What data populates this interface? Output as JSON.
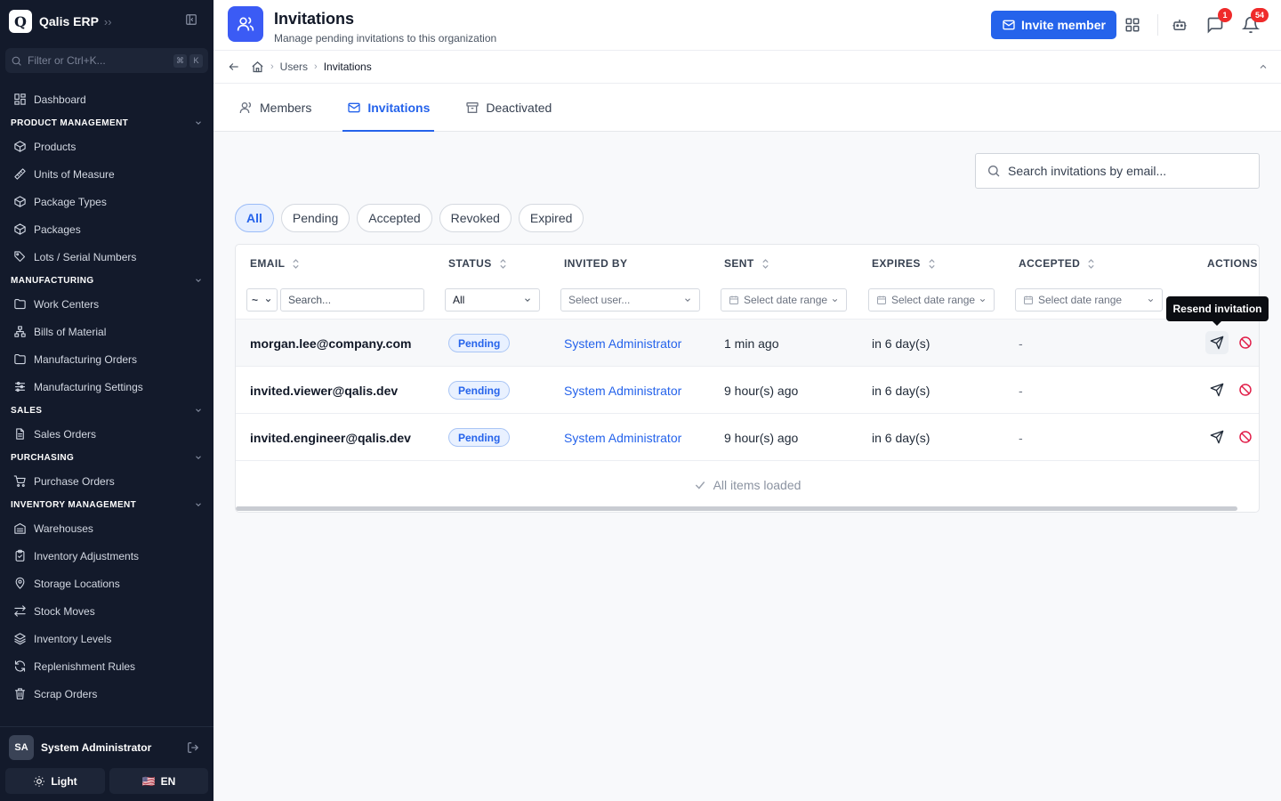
{
  "app": {
    "logo_letter": "Q",
    "name": "Qalis ERP"
  },
  "sidebar": {
    "filter_placeholder": "Filter or Ctrl+K...",
    "kbd": [
      "⌘",
      "K"
    ],
    "dashboard": "Dashboard",
    "sections": [
      {
        "title": "PRODUCT MANAGEMENT",
        "items": [
          {
            "label": "Products",
            "icon": "box-icon"
          },
          {
            "label": "Units of Measure",
            "icon": "ruler-icon"
          },
          {
            "label": "Package Types",
            "icon": "box-icon"
          },
          {
            "label": "Packages",
            "icon": "box-icon"
          },
          {
            "label": "Lots / Serial Numbers",
            "icon": "tag-icon"
          }
        ]
      },
      {
        "title": "MANUFACTURING",
        "items": [
          {
            "label": "Work Centers",
            "icon": "folder-icon"
          },
          {
            "label": "Bills of Material",
            "icon": "hierarchy-icon"
          },
          {
            "label": "Manufacturing Orders",
            "icon": "folder-icon"
          },
          {
            "label": "Manufacturing Settings",
            "icon": "sliders-icon"
          }
        ]
      },
      {
        "title": "SALES",
        "items": [
          {
            "label": "Sales Orders",
            "icon": "document-icon"
          }
        ]
      },
      {
        "title": "PURCHASING",
        "items": [
          {
            "label": "Purchase Orders",
            "icon": "cart-icon"
          }
        ]
      },
      {
        "title": "INVENTORY MANAGEMENT",
        "items": [
          {
            "label": "Warehouses",
            "icon": "warehouse-icon"
          },
          {
            "label": "Inventory Adjustments",
            "icon": "clipboard-icon"
          },
          {
            "label": "Storage Locations",
            "icon": "map-pin-icon"
          },
          {
            "label": "Stock Moves",
            "icon": "arrows-icon"
          },
          {
            "label": "Inventory Levels",
            "icon": "layers-icon"
          },
          {
            "label": "Replenishment Rules",
            "icon": "refresh-icon"
          },
          {
            "label": "Scrap Orders",
            "icon": "trash-icon"
          }
        ]
      }
    ],
    "user": {
      "initials": "SA",
      "name": "System Administrator"
    },
    "theme_label": "Light",
    "lang_label": "EN",
    "lang_flag": "🇺🇸"
  },
  "header": {
    "title": "Invitations",
    "subtitle": "Manage pending invitations to this organization",
    "invite_label": "Invite member",
    "chat_badge": "1",
    "notif_badge": "54"
  },
  "breadcrumb": {
    "items": [
      "Users"
    ],
    "current": "Invitations"
  },
  "tabs": [
    {
      "label": "Members",
      "active": false
    },
    {
      "label": "Invitations",
      "active": true
    },
    {
      "label": "Deactivated",
      "active": false
    }
  ],
  "search": {
    "placeholder": "Search invitations by email..."
  },
  "chips": [
    {
      "label": "All",
      "active": true
    },
    {
      "label": "Pending",
      "active": false
    },
    {
      "label": "Accepted",
      "active": false
    },
    {
      "label": "Revoked",
      "active": false
    },
    {
      "label": "Expired",
      "active": false
    }
  ],
  "table": {
    "columns": [
      "EMAIL",
      "STATUS",
      "INVITED BY",
      "SENT",
      "EXPIRES",
      "ACCEPTED",
      "ACTIONS"
    ],
    "filters": {
      "email_op": "~",
      "email_placeholder": "Search...",
      "status": "All",
      "invited_by": "Select user...",
      "sent": "Select date range",
      "expires": "Select date range",
      "accepted": "Select date range"
    },
    "rows": [
      {
        "email": "morgan.lee@company.com",
        "status": "Pending",
        "invited_by": "System Administrator",
        "sent": "1 min ago",
        "expires": "in 6 day(s)",
        "accepted": "-"
      },
      {
        "email": "invited.viewer@qalis.dev",
        "status": "Pending",
        "invited_by": "System Administrator",
        "sent": "9 hour(s) ago",
        "expires": "in 6 day(s)",
        "accepted": "-"
      },
      {
        "email": "invited.engineer@qalis.dev",
        "status": "Pending",
        "invited_by": "System Administrator",
        "sent": "9 hour(s) ago",
        "expires": "in 6 day(s)",
        "accepted": "-"
      }
    ],
    "footer": "All items loaded",
    "tooltip": "Resend invitation"
  },
  "colors": {
    "accent": "#2563eb",
    "sidebar_bg": "#131a2b",
    "badge": "#ef2a2a",
    "revoke": "#e11d48"
  }
}
